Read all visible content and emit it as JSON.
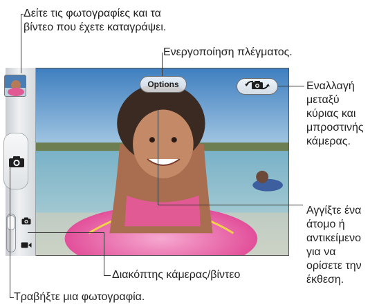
{
  "callouts": {
    "photos_line1": "Δείτε τις φωτογραφίες και τα",
    "photos_line2": "βίντεο που έχετε καταγράψει.",
    "grid": "Ενεργοποίηση πλέγματος.",
    "switch_cam_lines": [
      "Εναλλαγή",
      "μεταξύ",
      "κύριας και",
      "μπροστινής",
      "κάμερας."
    ],
    "expose_lines": [
      "Αγγίξτε ένα",
      "άτομο ή",
      "αντικείμενο",
      "για να",
      "ορίσετε την",
      "έκθεση."
    ],
    "toggle": "Διακόπτης κάμερας/βίντεο",
    "take_photo": "Τραβήξτε μια φωτογραφία."
  },
  "camera": {
    "options_label": "Options",
    "flip_icon": "camera-flip-icon",
    "shutter_icon": "camera-icon",
    "mode_photo_icon": "camera-icon",
    "mode_video_icon": "video-camera-icon",
    "mode": "photo"
  }
}
